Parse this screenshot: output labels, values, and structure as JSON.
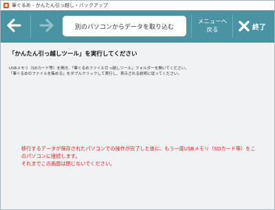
{
  "window": {
    "title": "筆ぐるめ - かんたん引っ越し・バックアップ"
  },
  "toolbar": {
    "center_title": "別のパソコンからデータを取り込む",
    "menu_line1": "メニューへ",
    "menu_line2": "戻る",
    "exit_label": "終了",
    "accent_color": "#4a93a2"
  },
  "content": {
    "heading": "「かんたん引っ越しツール」を実行してください",
    "instruction_line1": "USBメモリ（SDカード等）を開き、「筆ぐるめファイル引っ越しツール」フォルダーを開いてください。",
    "instruction_line2": "「筆ぐるめのファイルを集める」をダブルクリックして実行し、表示される説明に従ってください。",
    "warning_line1": "移行するデータが保存されたパソコンでの操作が完了した後に、もう一度USBメモリ（SDカード等）をこ",
    "warning_line2": "のパソコンに接続します。",
    "warning_line3": "それまでこの画面は閉じないでください。",
    "warning_color": "#e22020"
  }
}
